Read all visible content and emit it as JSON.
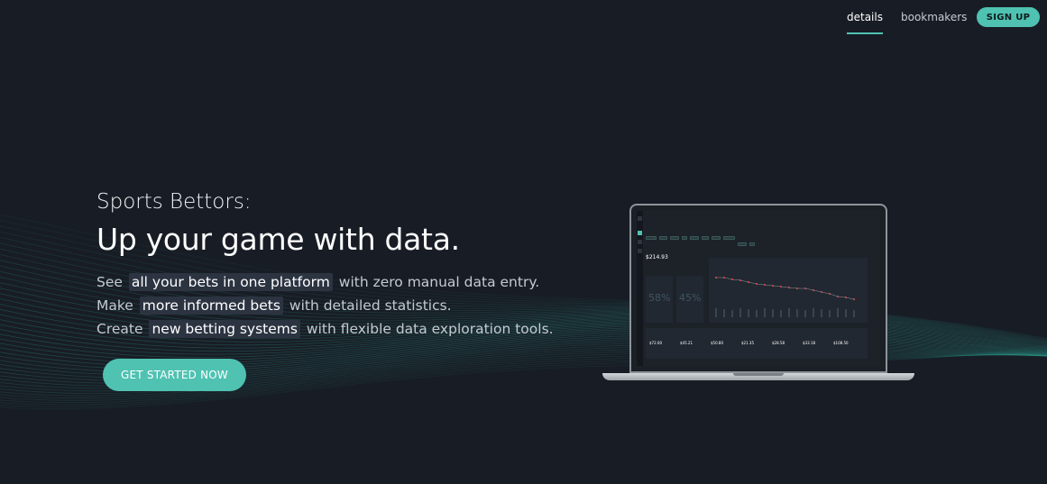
{
  "nav": {
    "details": "details",
    "bookmakers": "bookmakers",
    "signup": "SIGN UP"
  },
  "hero": {
    "eyebrow": "Sports Bettors:",
    "headline": "Up your game with data.",
    "lines": [
      {
        "pre": "See",
        "highlight": "all your bets in one platform",
        "post": "with zero manual data entry."
      },
      {
        "pre": "Make",
        "highlight": "more informed bets",
        "post": "with detailed statistics."
      },
      {
        "pre": "Create",
        "highlight": "new betting systems",
        "post": "with flexible data exploration tools."
      }
    ],
    "cta": "GET STARTED NOW"
  },
  "screenshot": {
    "balance": "$214.93",
    "stat1": "58%",
    "stat2": "45%",
    "values": [
      "$72.00",
      "$45.21",
      "$50.80",
      "$21.35",
      "$28.58",
      "$33.18",
      "$108.50"
    ]
  },
  "colors": {
    "background": "#181d25",
    "accent": "#4fc2b2",
    "highlight_bg": "#2c3442"
  }
}
